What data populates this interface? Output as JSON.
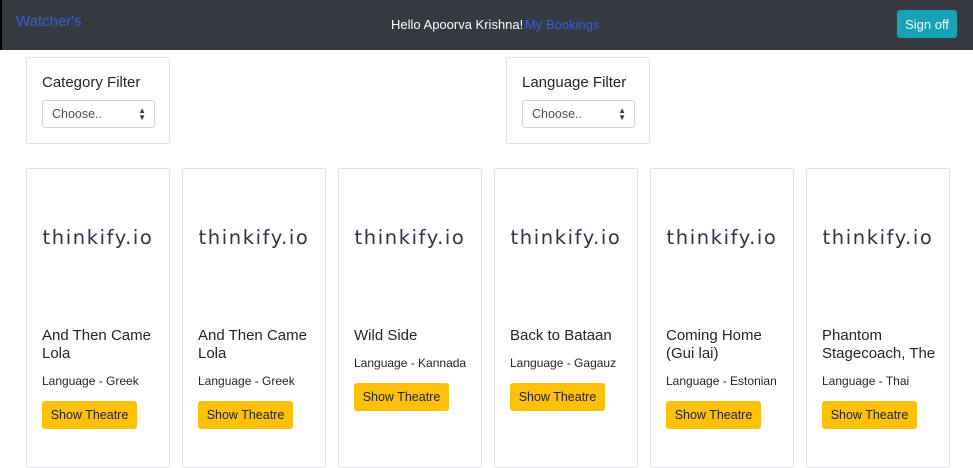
{
  "navbar": {
    "brand": "Watcher's",
    "greeting": "Hello Apoorva Krishna!",
    "bookings_link": "My Bookings",
    "signoff_label": "Sign off"
  },
  "filters": {
    "category": {
      "title": "Category Filter",
      "selected": "Choose.."
    },
    "language": {
      "title": "Language Filter",
      "selected": "Choose.."
    }
  },
  "movies": [
    {
      "logo": "thinkify.io",
      "title": "And Then Came Lola",
      "language": "Language - Greek",
      "button": "Show Theatre"
    },
    {
      "logo": "thinkify.io",
      "title": "And Then Came Lola",
      "language": "Language - Greek",
      "button": "Show Theatre"
    },
    {
      "logo": "thinkify.io",
      "title": "Wild Side",
      "language": "Language - Kannada",
      "button": "Show Theatre"
    },
    {
      "logo": "thinkify.io",
      "title": "Back to Bataan",
      "language": "Language - Gagauz",
      "button": "Show Theatre"
    },
    {
      "logo": "thinkify.io",
      "title": "Coming Home (Gui lai)",
      "language": "Language - Estonian",
      "button": "Show Theatre"
    },
    {
      "logo": "thinkify.io",
      "title": "Phantom Stagecoach, The",
      "language": "Language - Thai",
      "button": "Show Theatre"
    }
  ]
}
